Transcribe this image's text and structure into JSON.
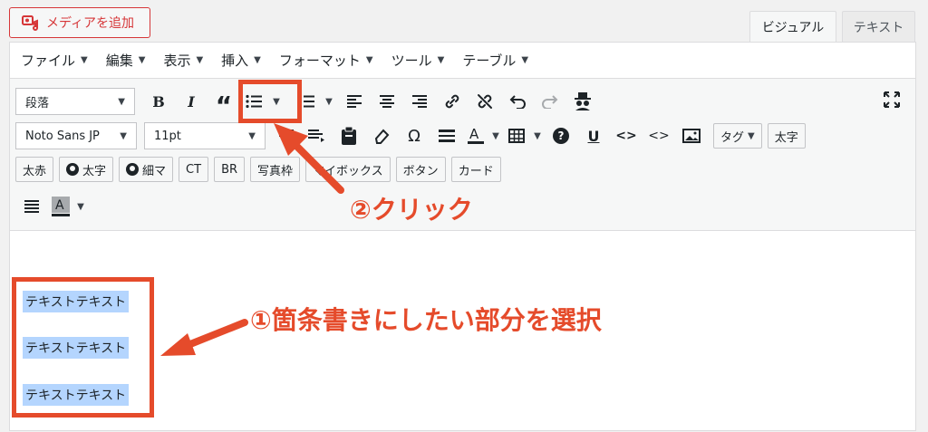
{
  "header": {
    "media_button_label": "メディアを追加",
    "tab_visual": "ビジュアル",
    "tab_text": "テキスト"
  },
  "menubar": {
    "items": [
      "ファイル",
      "編集",
      "表示",
      "挿入",
      "フォーマット",
      "ツール",
      "テーブル"
    ]
  },
  "toolbar": {
    "format_select": "段落",
    "font_select": "Noto Sans JP",
    "size_select": "11pt",
    "tag_button": "タグ",
    "bold_text_button": "太字",
    "buttons_row3": [
      "太赤",
      "太字",
      "細マ",
      "CT",
      "BR",
      "写真枠",
      "マイボックス",
      "ボタン",
      "カード"
    ],
    "bold_glyph": "B",
    "italic_glyph": "I",
    "quote_glyph": "“",
    "omega_glyph": "Ω",
    "underline_glyph": "U",
    "code_glyph": "<>",
    "help_glyph": "?"
  },
  "content": {
    "paragraphs": [
      "テキストテキスト",
      "テキストテキスト",
      "テキストテキスト"
    ]
  },
  "annotations": {
    "step1": "①箇条書きにしたい部分を選択",
    "step2": "②クリック"
  },
  "colors": {
    "annotation": "#e54b2b",
    "selection": "#b4d5fe",
    "media_button": "#d63638"
  }
}
